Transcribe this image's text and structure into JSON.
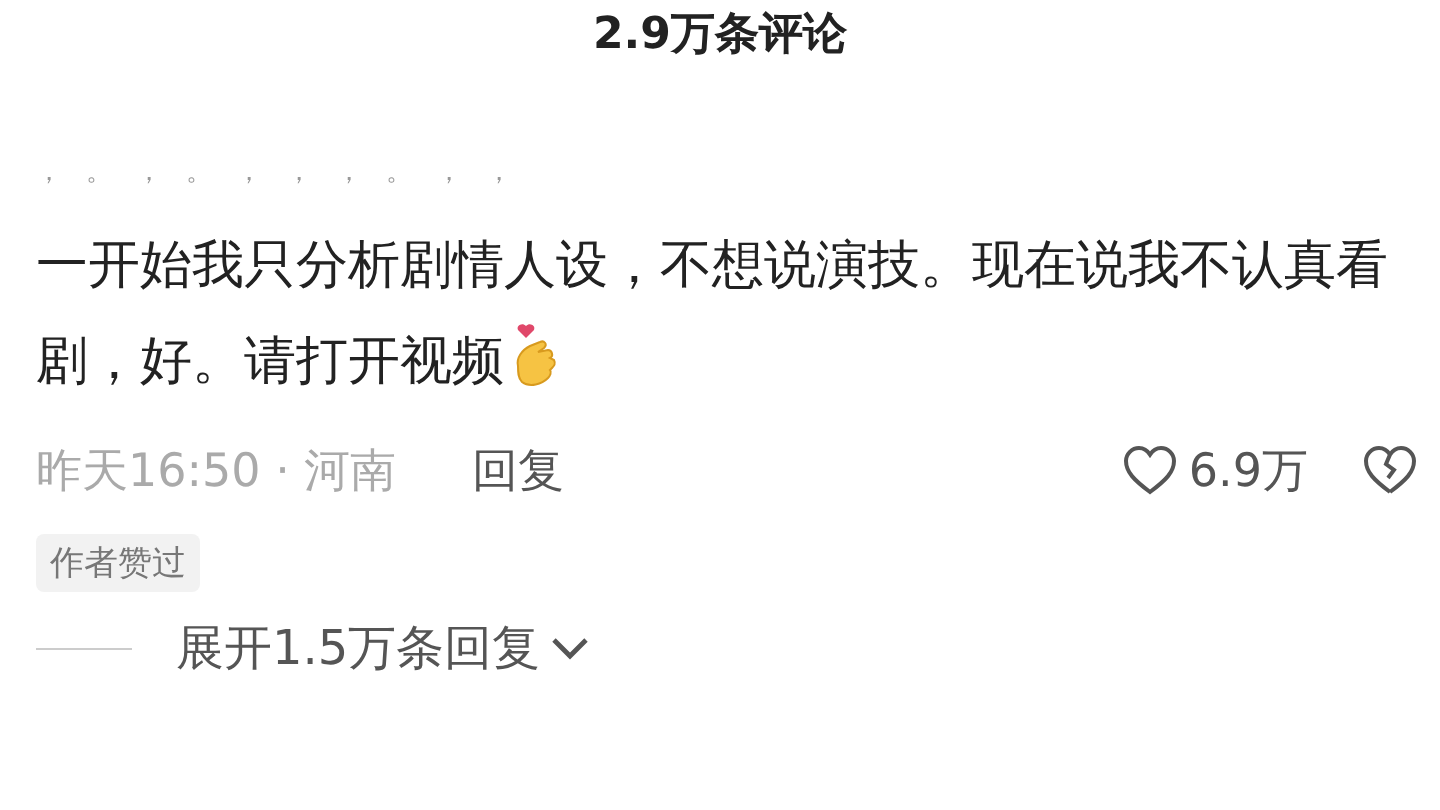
{
  "header": {
    "title": "2.9万条评论"
  },
  "comment": {
    "quote": "，。，。，，，。，，",
    "text": "一开始我只分析剧情人设，不想说演技。现在说我不认真看剧，好。请打开视频",
    "time": "昨天16:50 · 河南",
    "reply": "回复",
    "likes": "6.9万",
    "liked": false,
    "badge": "作者赞过",
    "expand": "展开1.5万条回复"
  }
}
